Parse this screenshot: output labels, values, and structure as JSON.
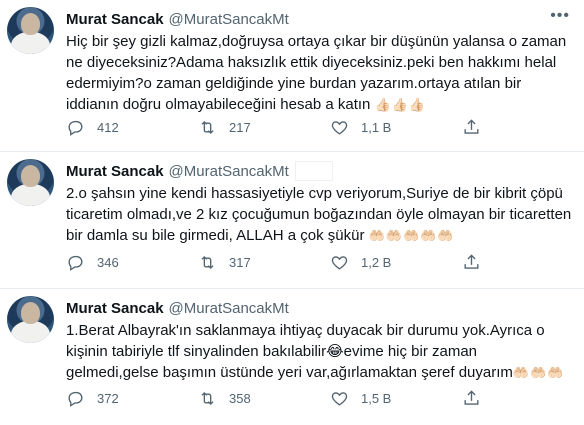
{
  "tweets": [
    {
      "name": "Murat Sancak",
      "handle": "@MuratSancakMt",
      "text": "Hiç bir şey gizli kalmaz,doğruysa ortaya çıkar bir düşünün yalansa o zaman\nne diyeceksiniz?Adama haksızlık ettik diyeceksiniz.peki ben hakkımı helal\nedermiyim?o zaman geldiğinde yine burdan yazarım.ortaya atılan bir\niddianın doğru olmayabileceğini hesab a katın",
      "emoji": "👍🏻👍🏻👍🏻",
      "replies": "412",
      "retweets": "217",
      "likes": "1,1 B"
    },
    {
      "name": "Murat Sancak",
      "handle": "@MuratSancakMt",
      "text": "2.o şahsın yine kendi hassasiyetiyle cvp veriyorum,Suriye de bir kibrit çöpü\nticaretim olmadı,ve 2 kız çocuğumun boğazından öyle olmayan bir ticaretten\nbir damla su bile girmedi, ALLAH a çok şükür",
      "emoji": "🤲🏻🤲🏻🤲🏻🤲🏻🤲🏻",
      "replies": "346",
      "retweets": "317",
      "likes": "1,2 B"
    },
    {
      "name": "Murat Sancak",
      "handle": "@MuratSancakMt",
      "text": "1.Berat Albayrak'ın saklanmaya ihtiyaç duyacak bir durumu yok.Ayrıca o\nkişinin tabiriyle tlf sinyalinden bakılabilir😂evime hiç bir zaman\ngelmedi,gelse başımın üstünde yeri var,ağırlamaktan şeref duyarım",
      "emoji": "🤲🏻🤲🏻🤲🏻",
      "replies": "372",
      "retweets": "358",
      "likes": "1,5 B"
    }
  ],
  "icons": {
    "reply": "reply-icon",
    "retweet": "retweet-icon",
    "like": "heart-icon",
    "share": "share-icon",
    "more": "more-icon",
    "color": "#536471"
  }
}
